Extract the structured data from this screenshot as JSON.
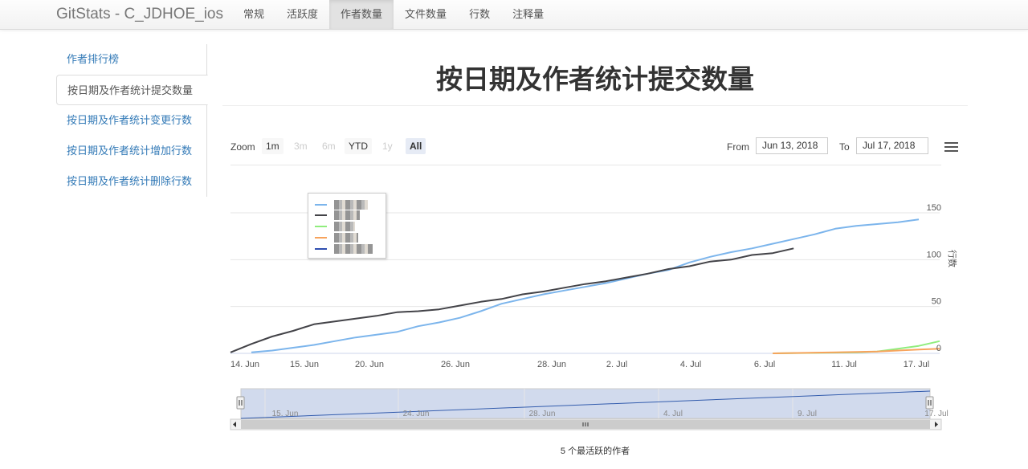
{
  "navbar": {
    "brand": "GitStats - C_JDHOE_ios",
    "items": [
      {
        "label": "常规"
      },
      {
        "label": "活跃度"
      },
      {
        "label": "作者数量",
        "active": true
      },
      {
        "label": "文件数量"
      },
      {
        "label": "行数"
      },
      {
        "label": "注释量"
      }
    ]
  },
  "sidebar": {
    "items": [
      {
        "label": "作者排行榜"
      },
      {
        "label": "按日期及作者统计提交数量",
        "active": true
      },
      {
        "label": "按日期及作者统计变更行数"
      },
      {
        "label": "按日期及作者统计增加行数"
      },
      {
        "label": "按日期及作者统计删除行数"
      }
    ]
  },
  "page": {
    "title": "按日期及作者统计提交数量"
  },
  "toolbar": {
    "zoom_label": "Zoom",
    "zoom_buttons": [
      {
        "label": "1m",
        "state": "enabled"
      },
      {
        "label": "3m",
        "state": "disabled"
      },
      {
        "label": "6m",
        "state": "disabled"
      },
      {
        "label": "YTD",
        "state": "enabled"
      },
      {
        "label": "1y",
        "state": "disabled"
      },
      {
        "label": "All",
        "state": "selected"
      }
    ],
    "from_label": "From",
    "from_value": "Jun 13, 2018",
    "to_label": "To",
    "to_value": "Jul 17, 2018",
    "menu_icon": "hamburger-menu-icon"
  },
  "chart_data": {
    "type": "line",
    "ylabel": "行数",
    "ylim": [
      0,
      150
    ],
    "yticks": [
      0,
      50,
      100,
      150
    ],
    "xlim": [
      "2018-06-14",
      "2018-07-18"
    ],
    "x_tick_labels": [
      "14. Jun",
      "15. Jun",
      "20. Jun",
      "26. Jun",
      "28. Jun",
      "2. Jul",
      "4. Jul",
      "6. Jul",
      "11. Jul",
      "17. Jul"
    ],
    "navigator_tick_labels": [
      "15. Jun",
      "24. Jun",
      "28. Jun",
      "4. Jul",
      "9. Jul",
      "17. Jul"
    ],
    "grid": true,
    "legend_position": "top-left",
    "series": [
      {
        "color": "#7cb5ec",
        "points": [
          [
            "2018-06-15",
            1
          ],
          [
            "2018-06-16",
            3
          ],
          [
            "2018-06-17",
            6
          ],
          [
            "2018-06-18",
            9
          ],
          [
            "2018-06-19",
            13
          ],
          [
            "2018-06-20",
            17
          ],
          [
            "2018-06-21",
            20
          ],
          [
            "2018-06-22",
            23
          ],
          [
            "2018-06-23",
            29
          ],
          [
            "2018-06-24",
            33
          ],
          [
            "2018-06-25",
            38
          ],
          [
            "2018-06-26",
            45
          ],
          [
            "2018-06-27",
            53
          ],
          [
            "2018-06-28",
            58
          ],
          [
            "2018-06-29",
            63
          ],
          [
            "2018-06-30",
            67
          ],
          [
            "2018-07-01",
            71
          ],
          [
            "2018-07-02",
            75
          ],
          [
            "2018-07-03",
            80
          ],
          [
            "2018-07-04",
            85
          ],
          [
            "2018-07-05",
            89
          ],
          [
            "2018-07-06",
            97
          ],
          [
            "2018-07-07",
            103
          ],
          [
            "2018-07-08",
            108
          ],
          [
            "2018-07-09",
            112
          ],
          [
            "2018-07-10",
            117
          ],
          [
            "2018-07-11",
            122
          ],
          [
            "2018-07-12",
            127
          ],
          [
            "2018-07-13",
            133
          ],
          [
            "2018-07-14",
            136
          ],
          [
            "2018-07-15",
            138
          ],
          [
            "2018-07-16",
            140
          ],
          [
            "2018-07-17",
            143
          ]
        ]
      },
      {
        "color": "#434348",
        "points": [
          [
            "2018-06-14",
            1
          ],
          [
            "2018-06-15",
            10
          ],
          [
            "2018-06-16",
            18
          ],
          [
            "2018-06-17",
            24
          ],
          [
            "2018-06-18",
            31
          ],
          [
            "2018-06-19",
            34
          ],
          [
            "2018-06-20",
            37
          ],
          [
            "2018-06-21",
            40
          ],
          [
            "2018-06-22",
            44
          ],
          [
            "2018-06-23",
            45
          ],
          [
            "2018-06-24",
            47
          ],
          [
            "2018-06-25",
            51
          ],
          [
            "2018-06-26",
            55
          ],
          [
            "2018-06-27",
            58
          ],
          [
            "2018-06-28",
            63
          ],
          [
            "2018-06-29",
            66
          ],
          [
            "2018-06-30",
            70
          ],
          [
            "2018-07-01",
            74
          ],
          [
            "2018-07-02",
            77
          ],
          [
            "2018-07-03",
            81
          ],
          [
            "2018-07-04",
            85
          ],
          [
            "2018-07-05",
            90
          ],
          [
            "2018-07-06",
            93
          ],
          [
            "2018-07-07",
            98
          ],
          [
            "2018-07-08",
            100
          ],
          [
            "2018-07-09",
            105
          ],
          [
            "2018-07-10",
            107
          ],
          [
            "2018-07-11",
            112
          ]
        ]
      },
      {
        "color": "#90ed7d",
        "points": [
          [
            "2018-07-10",
            0
          ],
          [
            "2018-07-14",
            1
          ],
          [
            "2018-07-15",
            2
          ],
          [
            "2018-07-16",
            5
          ],
          [
            "2018-07-17",
            8
          ],
          [
            "2018-07-18",
            13
          ]
        ]
      },
      {
        "color": "#f7a35c",
        "points": [
          [
            "2018-07-10",
            0
          ],
          [
            "2018-07-13",
            1
          ],
          [
            "2018-07-15",
            2
          ],
          [
            "2018-07-16",
            3
          ],
          [
            "2018-07-17",
            4
          ],
          [
            "2018-07-18",
            5
          ]
        ]
      },
      {
        "color": "#2f4eb0",
        "points": []
      }
    ]
  },
  "footer": {
    "caption": "5 个最活跃的作者"
  }
}
